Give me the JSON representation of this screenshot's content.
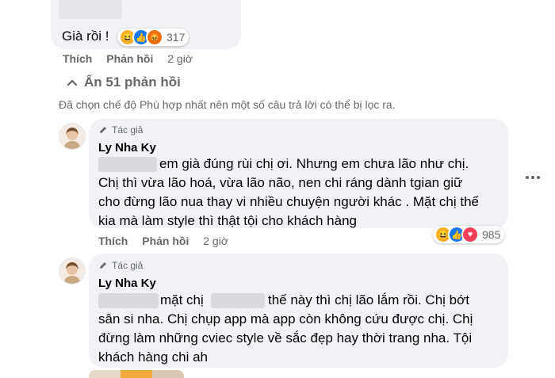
{
  "top_comment": {
    "text": "Già rồi !",
    "reaction_count": "317",
    "actions": {
      "like": "Thích",
      "reply": "Phản hồi",
      "time": "2 giờ"
    }
  },
  "hide_replies": {
    "label": "Ẩn 51 phản hồi"
  },
  "filter_notice": "Đã chọn chế độ Phù hợp nhất nên một số câu trả lời có thể bị lọc ra.",
  "replies": [
    {
      "author_tag": "Tác giả",
      "author_name": "Ly Nha Ky",
      "lines": [
        "em già đúng rùi chị ơi. Nhưng em chưa lão như chị.",
        "Chị thì vừa lão hoá, vừa lão não, nen chi ráng dành tgian giữ",
        "cho đừng lão nua thay vi nhiều chuyện người khác . Mặt chị thế",
        "kia mà làm style thì thật tội cho khách hàng"
      ],
      "actions": {
        "like": "Thích",
        "reply": "Phản hồi",
        "time": "2 giờ"
      },
      "reaction_count": "985"
    },
    {
      "author_tag": "Tác giả",
      "author_name": "Ly Nha Ky",
      "lines": [
        "mặt chị",
        "thế này thì chị lão lắm rồi. Chị bớt",
        "sân si nha. Chị chụp app mà app còn không cứu được chị. Chị",
        "đừng làm những cviec style về sắc đẹp hay thời trang nha. Tội",
        "khách hàng chi ah"
      ]
    }
  ],
  "colors": {
    "bubble": "#f0f2f5",
    "secondary_text": "#65676b",
    "like_blue": "#1877f2",
    "haha_yellow": "#f7b125",
    "angry_orange": "#e9710f",
    "love_red": "#f33e58"
  }
}
